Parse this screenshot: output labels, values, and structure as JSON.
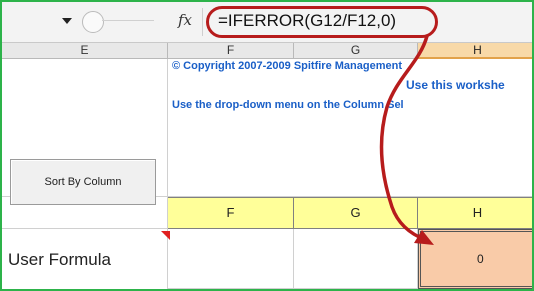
{
  "formula_bar": {
    "fx_label": "fx",
    "formula": "=IFERROR(G12/F12,0)"
  },
  "columns": {
    "header_letters": [
      "E",
      "F",
      "G",
      "H"
    ],
    "selected": "H"
  },
  "sheet": {
    "copyright_text": "© Copyright 2007-2009 Spitfire Management",
    "instruction_1": "Use this workshe",
    "instruction_2": "Use the drop-down menu on the Column Sel",
    "sort_button_label": "Sort By Column",
    "yellow_row": [
      "F",
      "G",
      "H"
    ],
    "user_formula_label": "User Formula",
    "h_value": "0"
  },
  "colors": {
    "frame_border": "#2db34a",
    "annotation_red": "#b71c1c",
    "header_row_yellow": "#ffff99",
    "highlight_cell": "#f9cba8",
    "link_blue": "#1a5fc7"
  }
}
